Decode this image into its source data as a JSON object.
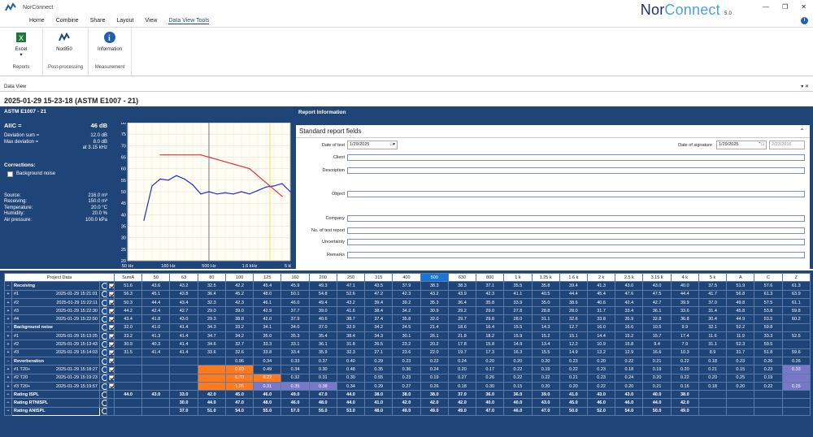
{
  "window": {
    "title": "NorConnect",
    "brand_part1": "Nor",
    "brand_part2": "Connect",
    "version": "5.0"
  },
  "menu": [
    "Home",
    "Combine",
    "Share",
    "Layout",
    "View",
    "Data View Tools"
  ],
  "ribbon": {
    "groups": [
      {
        "label": "Reports",
        "buttons": [
          "Excel"
        ]
      },
      {
        "label": "Post-processing",
        "buttons": [
          "Nor850"
        ]
      },
      {
        "label": "Measurement",
        "buttons": [
          "Information"
        ]
      }
    ]
  },
  "dataview": {
    "label": "Data View",
    "doc_title": "2025-01-29 15-23-18 (ASTM E1007 - 21)"
  },
  "left_panel": {
    "title": "ASTM E1007 - 21",
    "aiic_label": "AIIC =",
    "aiic_value": "46 dB",
    "dev_sum_label": "Deviation sum =",
    "dev_sum_value": "12.0 dB",
    "max_dev_label": "Max deviation =",
    "max_dev_value": "8.0 dB",
    "max_dev_at": "at 3.15 kHz",
    "corrections_label": "Corrections:",
    "background_noise_label": "Background noise",
    "params": [
      {
        "k": "Source:",
        "v": "216.0 m³"
      },
      {
        "k": "Receiving:",
        "v": "150.0 m³"
      },
      {
        "k": "Temperature:",
        "v": "20.0 °C"
      },
      {
        "k": "Humidity:",
        "v": "20.0 %"
      },
      {
        "k": "Air pressure:",
        "v": "100.0 kPa"
      }
    ]
  },
  "chart_data": {
    "type": "line",
    "x": [
      "50 Hz",
      "63",
      "80",
      "100",
      "125",
      "160 Hz",
      "200",
      "250",
      "315",
      "400",
      "500 Hz",
      "630",
      "800",
      "1k",
      "1.25k",
      "1.6 kHz",
      "2k",
      "2.5k",
      "3.15k",
      "4k",
      "5 kHz"
    ],
    "xticklabels": [
      "50 Hz",
      "160 Hz",
      "500 Hz",
      "1.6 kHz",
      "5 kHz"
    ],
    "ylim": [
      20,
      80
    ],
    "yticks": [
      20,
      25,
      30,
      35,
      40,
      45,
      50,
      55,
      60,
      65,
      70,
      75,
      80
    ],
    "series": [
      {
        "color": "#1a2fd0",
        "values": [
          null,
          null,
          37.5,
          52.5,
          55.5,
          55.0,
          57.0,
          55.5,
          53.0,
          49.0,
          50.0,
          49.0,
          49.5,
          49.0,
          50.0,
          49.0,
          50.5,
          52.0,
          52.5,
          53.5,
          50.0
        ]
      },
      {
        "color": "#e03040",
        "values": [
          null,
          null,
          null,
          null,
          66.0,
          66.0,
          66.0,
          66.0,
          66.0,
          66.0,
          65.0,
          64.0,
          63.0,
          62.0,
          61.0,
          60.0,
          57.0,
          54.0,
          51.0,
          48.0,
          null
        ]
      }
    ],
    "vlines": [
      {
        "x": 10,
        "color": "#777"
      },
      {
        "x": 17.5,
        "color": "#f5e05a"
      }
    ]
  },
  "right_panel": {
    "title": "Report Information",
    "section_title": "Standard report fields",
    "date_of_test_label": "Date of test",
    "date_of_test": "1/29/2025",
    "date_of_signature_label": "Date of signature",
    "date_of_signature": "1/29/2025",
    "date_second": "2/23/2016",
    "fields": [
      "Client",
      "Description",
      "Object",
      "Company",
      "No. of test report",
      "Uncertainty",
      "Remarks"
    ]
  },
  "table": {
    "headers": [
      "Project Data",
      "SumA",
      "50",
      "63",
      "80",
      "100",
      "125",
      "160",
      "200",
      "250",
      "315",
      "400",
      "500",
      "630",
      "800",
      "1 k",
      "1.25 k",
      "1.6 k",
      "2 k",
      "2.5 k",
      "3.15 k",
      "4 k",
      "5 k",
      "A",
      "C",
      "Z"
    ],
    "rows": [
      {
        "kind": "group",
        "label": "Receiving",
        "vals": [
          "51.6",
          "43.6",
          "43.2",
          "32.5",
          "42.2",
          "45.4",
          "45.9",
          "49.3",
          "47.1",
          "43.5",
          "37.9",
          "38.3",
          "38.3",
          "37.1",
          "35.5",
          "35.8",
          "39.4",
          "41.3",
          "43.0",
          "43.0",
          "40.0",
          "37.5",
          "51.9",
          "57.6",
          "61.3"
        ]
      },
      {
        "kind": "sub",
        "label": "#1",
        "time": "2025-01-29 15:21:01",
        "vals": [
          "56.3",
          "45.1",
          "43.8",
          "36.4",
          "45.2",
          "48.0",
          "50.1",
          "54.8",
          "52.6",
          "47.2",
          "42.3",
          "43.2",
          "43.9",
          "42.3",
          "41.1",
          "40.5",
          "44.4",
          "45.4",
          "47.6",
          "47.5",
          "44.4",
          "41.7",
          "56.8",
          "61.3",
          "63.9"
        ]
      },
      {
        "kind": "sub",
        "label": "#2",
        "time": "2025-01-29 15:22:11",
        "vals": [
          "50.3",
          "44.4",
          "43.4",
          "32.3",
          "42.3",
          "46.1",
          "46.0",
          "49.4",
          "43.2",
          "39.4",
          "39.2",
          "35.3",
          "36.4",
          "35.8",
          "33.9",
          "35.0",
          "38.6",
          "40.6",
          "42.4",
          "42.7",
          "39.9",
          "37.0",
          "49.8",
          "57.5",
          "61.1"
        ]
      },
      {
        "kind": "sub",
        "label": "#3",
        "time": "2025-01-29 15:22:30",
        "vals": [
          "44.2",
          "42.4",
          "42.7",
          "29.0",
          "39.0",
          "42.9",
          "37.7",
          "39.0",
          "41.6",
          "38.4",
          "34.2",
          "30.9",
          "29.2",
          "29.0",
          "27.8",
          "28.8",
          "28.0",
          "31.7",
          "33.4",
          "36.1",
          "33.6",
          "31.4",
          "45.8",
          "53.8",
          "59.8"
        ]
      },
      {
        "kind": "sub",
        "label": "#4",
        "time": "2025-01-29 15:22:50",
        "vals": [
          "43.4",
          "41.8",
          "43.0",
          "29.3",
          "38.8",
          "42.0",
          "37.9",
          "40.6",
          "38.7",
          "37.4",
          "35.8",
          "32.0",
          "29.7",
          "29.8",
          "28.0",
          "31.1",
          "32.6",
          "33.8",
          "35.9",
          "32.8",
          "36.8",
          "30.4",
          "44.9",
          "53.5",
          "60.2"
        ]
      },
      {
        "kind": "group",
        "label": "Background noise",
        "vals": [
          "32.0",
          "41.0",
          "41.4",
          "34.3",
          "33.2",
          "34.1",
          "34.0",
          "37.0",
          "32.9",
          "34.2",
          "24.5",
          "21.4",
          "18.6",
          "16.4",
          "15.5",
          "14.3",
          "12.7",
          "16.0",
          "16.6",
          "10.5",
          "9.9",
          "32.1",
          "52.2",
          "59.8"
        ]
      },
      {
        "kind": "sub",
        "label": "#1",
        "time": "2025-01-29 15:13:25",
        "vals": [
          "33.2",
          "41.3",
          "41.4",
          "34.7",
          "34.2",
          "35.0",
          "35.3",
          "35.4",
          "38.4",
          "34.3",
          "30.1",
          "26.1",
          "21.8",
          "18.2",
          "15.9",
          "15.2",
          "15.1",
          "14.4",
          "15.2",
          "15.7",
          "17.4",
          "11.6",
          "11.9",
          "33.3",
          "52.5",
          "60.4"
        ]
      },
      {
        "kind": "sub",
        "label": "#2",
        "time": "2025-01-29 15:13:43",
        "vals": [
          "30.9",
          "40.3",
          "41.4",
          "34.6",
          "32.7",
          "33.3",
          "33.1",
          "36.1",
          "31.8",
          "26.5",
          "23.2",
          "20.2",
          "17.8",
          "15.8",
          "14.9",
          "13.4",
          "12.2",
          "10.9",
          "15.8",
          "9.4",
          "7.9",
          "31.1",
          "52.3",
          "59.5"
        ]
      },
      {
        "kind": "sub",
        "label": "#3",
        "time": "2025-01-29 15:14:03",
        "vals": [
          "31.5",
          "41.4",
          "41.4",
          "33.6",
          "32.6",
          "33.8",
          "33.4",
          "35.9",
          "32.3",
          "27.1",
          "23.6",
          "22.0",
          "19.7",
          "17.3",
          "16.3",
          "15.5",
          "14.9",
          "13.2",
          "12.9",
          "16.6",
          "10.3",
          "8.9",
          "31.7",
          "51.8",
          "59.6"
        ]
      },
      {
        "kind": "group",
        "label": "Reverberation",
        "vals": [
          "",
          "",
          "",
          "",
          "0.96",
          "0.34",
          "0.33",
          "0.37",
          "0.40",
          "0.29",
          "0.23",
          "0.22",
          "0.24",
          "0.20",
          "0.20",
          "0.20",
          "0.23",
          "0.20",
          "0.22",
          "0.21",
          "0.22",
          "0.18",
          "0.23",
          "0.26",
          "0.26"
        ]
      },
      {
        "kind": "rev",
        "label": "#1 T20+",
        "time": "2025-01-29 15:18:27",
        "vals": [
          "",
          "",
          "",
          "",
          "0.93",
          "0.49",
          "0.34",
          "0.30",
          "0.48",
          "0.35",
          "0.36",
          "0.24",
          "0.20",
          "0.17",
          "0.22",
          "0.19",
          "0.22",
          "0.23",
          "0.18",
          "0.19",
          "0.20",
          "0.21",
          "0.15",
          "0.23",
          "0.33"
        ]
      },
      {
        "kind": "rev",
        "label": "#2 T20",
        "time": "2025-01-29 15:19:23",
        "vals": [
          "",
          "",
          "",
          "",
          "0.70",
          "0.22",
          "0.32",
          "0.31",
          "0.30",
          "0.55",
          "0.23",
          "0.19",
          "0.27",
          "0.26",
          "0.22",
          "0.22",
          "0.21",
          "0.23",
          "0.24",
          "0.20",
          "0.22",
          "0.20",
          "0.25",
          "0.19"
        ]
      },
      {
        "kind": "rev",
        "label": "#3 T20+",
        "time": "2025-01-29 15:19:57",
        "vals": [
          "",
          "",
          "",
          "",
          "1.26",
          "0.31",
          "0.35",
          "0.38",
          "0.34",
          "0.29",
          "0.27",
          "0.26",
          "0.18",
          "0.30",
          "0.15",
          "0.20",
          "0.20",
          "0.22",
          "0.20",
          "0.21",
          "0.16",
          "0.18",
          "0.20",
          "0.22",
          "0.25"
        ]
      },
      {
        "kind": "rating",
        "label": "Rating ISPL",
        "vals": [
          "44.0",
          "43.0",
          "33.0",
          "42.0",
          "45.0",
          "46.0",
          "49.0",
          "47.0",
          "44.0",
          "38.0",
          "38.0",
          "38.0",
          "37.0",
          "36.0",
          "36.0",
          "39.0",
          "41.0",
          "43.0",
          "43.0",
          "40.0",
          "38.0"
        ]
      },
      {
        "kind": "rating",
        "label": "Rating RTNISPL",
        "vals": [
          "",
          "",
          "30.0",
          "44.0",
          "47.0",
          "48.0",
          "46.0",
          "48.0",
          "44.0",
          "41.0",
          "42.0",
          "42.0",
          "42.0",
          "40.0",
          "40.0",
          "43.0",
          "45.0",
          "46.0",
          "46.0",
          "44.0",
          "42.0"
        ]
      },
      {
        "kind": "rating",
        "label": "Rating ANISPL",
        "vals": [
          "",
          "",
          "37.0",
          "51.0",
          "54.0",
          "55.0",
          "57.0",
          "55.0",
          "53.0",
          "48.0",
          "49.0",
          "49.0",
          "49.0",
          "47.0",
          "46.0",
          "47.0",
          "50.0",
          "52.0",
          "54.0",
          "50.0",
          "49.0"
        ]
      }
    ]
  }
}
